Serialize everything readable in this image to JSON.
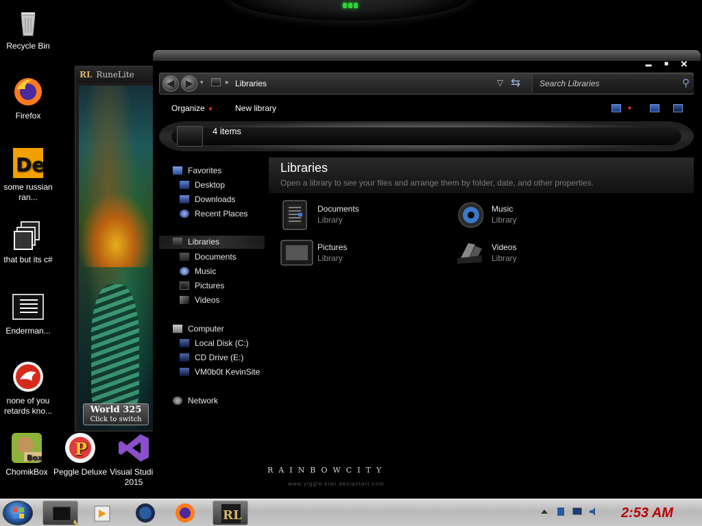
{
  "desktop": {
    "icons": [
      {
        "label": "Recycle Bin",
        "icon": "recycle-bin-icon"
      },
      {
        "label": "Firefox",
        "icon": "firefox-icon"
      },
      {
        "label": "some russian ran...",
        "icon": "de-app-icon"
      },
      {
        "label": "that but its c#",
        "icon": "copy-stack-icon"
      },
      {
        "label": "Enderman...",
        "icon": "text-document-icon"
      },
      {
        "label": "none of you retards kno...",
        "icon": "red-dragon-icon"
      },
      {
        "label": "ChomikBox",
        "icon": "chomikbox-icon"
      },
      {
        "label": "Peggle Deluxe",
        "icon": "peggle-icon"
      },
      {
        "label": "Visual Studio 2015",
        "icon": "visual-studio-icon"
      }
    ]
  },
  "runelite": {
    "logo": "RL",
    "title": "RuneLite",
    "world_label": "World 325",
    "world_hint": "Click to switch"
  },
  "explorer": {
    "window_controls": {
      "minimize": "▬",
      "maximize": "■",
      "close": "✕"
    },
    "address": "Libraries",
    "search_placeholder": "Search Libraries",
    "commands": {
      "organize": "Organize",
      "new_library": "New library"
    },
    "item_count": "4 items",
    "nav": {
      "favorites": "Favorites",
      "desktop": "Desktop",
      "downloads": "Downloads",
      "recent_places": "Recent Places",
      "libraries": "Libraries",
      "documents": "Documents",
      "music": "Music",
      "pictures": "Pictures",
      "videos": "Videos",
      "computer": "Computer",
      "local_disk": "Local Disk (C:)",
      "cd_drive": "CD Drive (E:)",
      "network_share": "VM0b0t KevinSite",
      "network": "Network"
    },
    "content": {
      "title": "Libraries",
      "subtitle": "Open a library to see your files and arrange them by folder, date, and other properties.",
      "libraries": [
        {
          "name": "Documents",
          "type": "Library",
          "icon": "documents-library-icon"
        },
        {
          "name": "Music",
          "type": "Library",
          "icon": "music-library-icon"
        },
        {
          "name": "Pictures",
          "type": "Library",
          "icon": "pictures-library-icon"
        },
        {
          "name": "Videos",
          "type": "Library",
          "icon": "videos-library-icon"
        }
      ]
    }
  },
  "wallpaper": {
    "brand": "RAINBOWCITY",
    "url": "www.yiggle-kiwi.deviantart.com"
  },
  "taskbar": {
    "clock": "2:53 AM",
    "accent_color": "#b80000"
  }
}
